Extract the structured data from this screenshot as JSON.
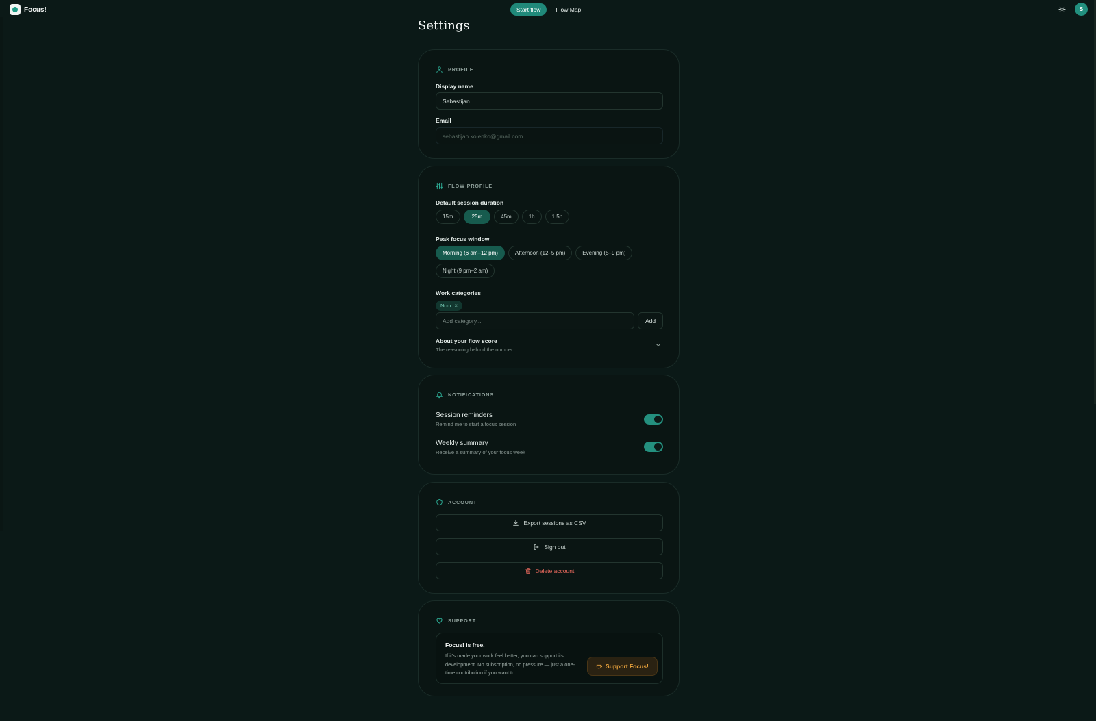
{
  "app": {
    "name": "Focus!"
  },
  "nav": {
    "start_flow": "Start flow",
    "flow_map": "Flow Map"
  },
  "user": {
    "avatar_initial": "S"
  },
  "page": {
    "title": "Settings"
  },
  "profile": {
    "header": "PROFILE",
    "display_name_label": "Display name",
    "display_name_value": "Sebastijan",
    "email_label": "Email",
    "email_value": "sebastijan.kolenko@gmail.com"
  },
  "flow_profile": {
    "header": "FLOW PROFILE",
    "duration_label": "Default session duration",
    "durations": [
      "15m",
      "25m",
      "45m",
      "1h",
      "1.5h"
    ],
    "selected_duration": "25m",
    "peak_label": "Peak focus window",
    "peak_options": [
      "Morning (6 am–12 pm)",
      "Afternoon (12–5 pm)",
      "Evening (5–9 pm)",
      "Night (9 pm–2 am)"
    ],
    "selected_peak": "Morning (6 am–12 pm)",
    "categories_label": "Work categories",
    "categories": [
      "Ncm"
    ],
    "category_remove_glyph": "×",
    "category_placeholder": "Add category...",
    "add_label": "Add",
    "score_title": "About your flow score",
    "score_subtitle": "The reasoning behind the number"
  },
  "notifications": {
    "header": "NOTIFICATIONS",
    "items": [
      {
        "title": "Session reminders",
        "subtitle": "Remind me to start a focus session",
        "enabled": true
      },
      {
        "title": "Weekly summary",
        "subtitle": "Receive a summary of your focus week",
        "enabled": true
      }
    ]
  },
  "account": {
    "header": "ACCOUNT",
    "export_label": "Export sessions as CSV",
    "signout_label": "Sign out",
    "delete_label": "Delete account"
  },
  "support": {
    "header": "SUPPORT",
    "title": "Focus! is free.",
    "text": "If it's made your work feel better, you can support its development. No subscription, no pressure — just a one-time contribution if you want to.",
    "button_label": "Support Focus!"
  },
  "colors": {
    "background": "#0b1917",
    "accent": "#20897a",
    "danger": "#ef6b5f",
    "support": "#e8a23c"
  }
}
